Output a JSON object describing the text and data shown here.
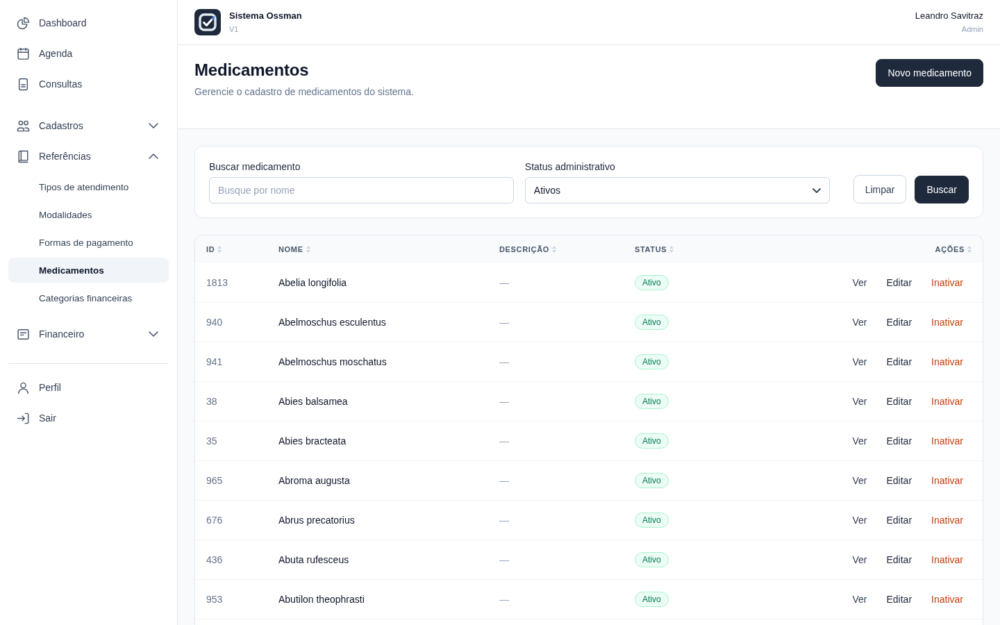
{
  "sidebar": {
    "main_items": [
      {
        "label": "Dashboard",
        "selected": false
      },
      {
        "label": "Agenda",
        "selected": false
      },
      {
        "label": "Consultas",
        "selected": false
      }
    ],
    "groups": [
      {
        "label": "Cadastros",
        "expanded": false
      },
      {
        "label": "Referências",
        "expanded": true,
        "children": [
          {
            "label": "Tipos de atendimento",
            "selected": false
          },
          {
            "label": "Modalidades",
            "selected": false
          },
          {
            "label": "Formas de pagamento",
            "selected": false
          },
          {
            "label": "Medicamentos",
            "selected": true
          },
          {
            "label": "Categorias financeiras",
            "selected": false
          }
        ]
      },
      {
        "label": "Financeiro",
        "expanded": false
      }
    ],
    "footer_items": [
      {
        "label": "Perfil",
        "selected": false
      },
      {
        "label": "Sair",
        "selected": false
      }
    ]
  },
  "topbar": {
    "app_name": "Sistema Ossman",
    "app_version": "V1",
    "user_name": "Leandro Savitraz",
    "user_role": "Admin"
  },
  "page": {
    "title": "Medicamentos",
    "subtitle": "Gerencie o cadastro de medicamentos do sistema.",
    "new_button": "Novo medicamento"
  },
  "filters": {
    "search": {
      "label": "Buscar medicamento",
      "placeholder": "Busque por nome"
    },
    "status": {
      "label": "Status administrativo",
      "value": "Ativos"
    },
    "buttons": [
      {
        "label": "Limpar",
        "kind": "reset"
      },
      {
        "label": "Buscar",
        "kind": "submit"
      }
    ]
  },
  "table": {
    "columns": [
      {
        "label": "ID"
      },
      {
        "label": "NOME"
      },
      {
        "label": "DESCRIÇÃO"
      },
      {
        "label": "STATUS"
      },
      {
        "label": "AÇÕES"
      }
    ],
    "rows": [
      {
        "id": "1813",
        "name": "Abelia longifolia",
        "description": "—",
        "status": {
          "label": "Ativo",
          "kind": "active"
        },
        "actions": [
          {
            "label": "Ver",
            "kind": "view"
          },
          {
            "label": "Editar",
            "kind": "edit"
          },
          {
            "label": "Inativar",
            "kind": "deactivate"
          }
        ]
      },
      {
        "id": "940",
        "name": "Abelmoschus esculentus",
        "description": "—",
        "status": {
          "label": "Ativo",
          "kind": "active"
        },
        "actions": [
          {
            "label": "Ver",
            "kind": "view"
          },
          {
            "label": "Editar",
            "kind": "edit"
          },
          {
            "label": "Inativar",
            "kind": "deactivate"
          }
        ]
      },
      {
        "id": "941",
        "name": "Abelmoschus moschatus",
        "description": "—",
        "status": {
          "label": "Ativo",
          "kind": "active"
        },
        "actions": [
          {
            "label": "Ver",
            "kind": "view"
          },
          {
            "label": "Editar",
            "kind": "edit"
          },
          {
            "label": "Inativar",
            "kind": "deactivate"
          }
        ]
      },
      {
        "id": "38",
        "name": "Abies balsamea",
        "description": "—",
        "status": {
          "label": "Ativo",
          "kind": "active"
        },
        "actions": [
          {
            "label": "Ver",
            "kind": "view"
          },
          {
            "label": "Editar",
            "kind": "edit"
          },
          {
            "label": "Inativar",
            "kind": "deactivate"
          }
        ]
      },
      {
        "id": "35",
        "name": "Abies bracteata",
        "description": "—",
        "status": {
          "label": "Ativo",
          "kind": "active"
        },
        "actions": [
          {
            "label": "Ver",
            "kind": "view"
          },
          {
            "label": "Editar",
            "kind": "edit"
          },
          {
            "label": "Inativar",
            "kind": "deactivate"
          }
        ]
      },
      {
        "id": "965",
        "name": "Abroma augusta",
        "description": "—",
        "status": {
          "label": "Ativo",
          "kind": "active"
        },
        "actions": [
          {
            "label": "Ver",
            "kind": "view"
          },
          {
            "label": "Editar",
            "kind": "edit"
          },
          {
            "label": "Inativar",
            "kind": "deactivate"
          }
        ]
      },
      {
        "id": "676",
        "name": "Abrus precatorius",
        "description": "—",
        "status": {
          "label": "Ativo",
          "kind": "active"
        },
        "actions": [
          {
            "label": "Ver",
            "kind": "view"
          },
          {
            "label": "Editar",
            "kind": "edit"
          },
          {
            "label": "Inativar",
            "kind": "deactivate"
          }
        ]
      },
      {
        "id": "436",
        "name": "Abuta rufesceus",
        "description": "—",
        "status": {
          "label": "Ativo",
          "kind": "active"
        },
        "actions": [
          {
            "label": "Ver",
            "kind": "view"
          },
          {
            "label": "Editar",
            "kind": "edit"
          },
          {
            "label": "Inativar",
            "kind": "deactivate"
          }
        ]
      },
      {
        "id": "953",
        "name": "Abutilon theophrasti",
        "description": "—",
        "status": {
          "label": "Ativo",
          "kind": "active"
        },
        "actions": [
          {
            "label": "Ver",
            "kind": "view"
          },
          {
            "label": "Editar",
            "kind": "edit"
          },
          {
            "label": "Inativar",
            "kind": "deactivate"
          }
        ]
      }
    ]
  }
}
